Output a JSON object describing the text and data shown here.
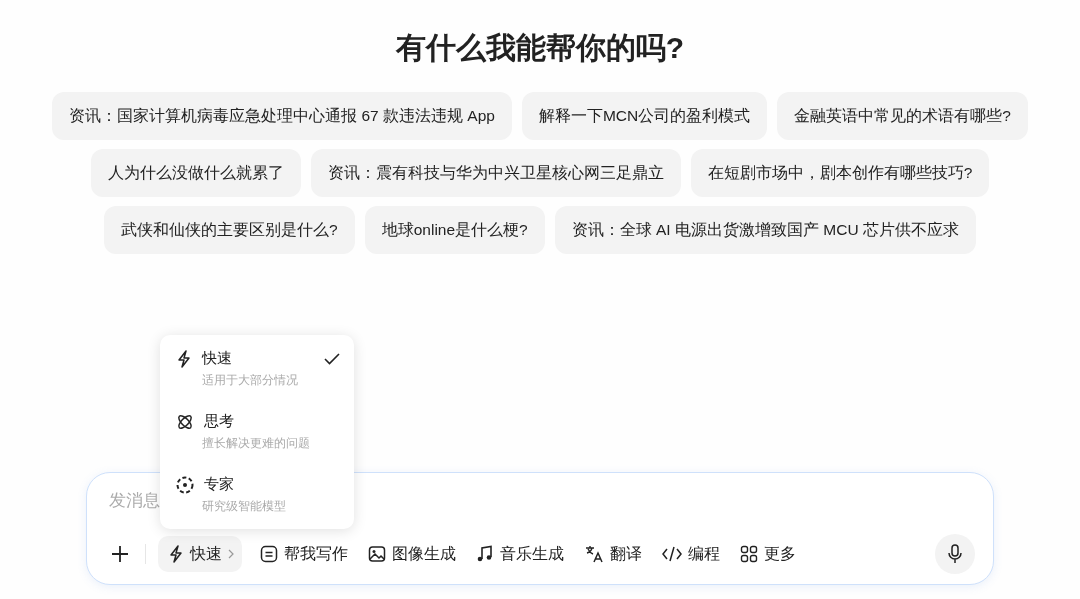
{
  "heading": "有什么我能帮你的吗?",
  "suggestion_rows": [
    [
      "资讯：国家计算机病毒应急处理中心通报 67 款违法违规 App",
      "解释一下MCN公司的盈利模式",
      "金融英语中常见的术语有哪些?"
    ],
    [
      "人为什么没做什么就累了",
      "资讯：震有科技与华为中兴卫星核心网三足鼎立",
      "在短剧市场中，剧本创作有哪些技巧?"
    ],
    [
      "武侠和仙侠的主要区别是什么?",
      "地球online是什么梗?",
      "资讯：全球 AI 电源出货激增致国产 MCU 芯片供不应求"
    ]
  ],
  "composer": {
    "placeholder": "发消息",
    "mode_button": {
      "kind": "bolt",
      "label": "快速"
    },
    "tools": [
      {
        "kind": "write",
        "label": "帮我写作"
      },
      {
        "kind": "image",
        "label": "图像生成"
      },
      {
        "kind": "music",
        "label": "音乐生成"
      },
      {
        "kind": "translate",
        "label": "翻译"
      },
      {
        "kind": "code",
        "label": "编程"
      },
      {
        "kind": "grid",
        "label": "更多"
      }
    ]
  },
  "mode_menu": [
    {
      "kind": "bolt",
      "title": "快速",
      "description": "适用于大部分情况",
      "selected": true
    },
    {
      "kind": "atom",
      "title": "思考",
      "description": "擅长解决更难的问题",
      "selected": false
    },
    {
      "kind": "expert",
      "title": "专家",
      "description": "研究级智能模型",
      "selected": false
    }
  ]
}
